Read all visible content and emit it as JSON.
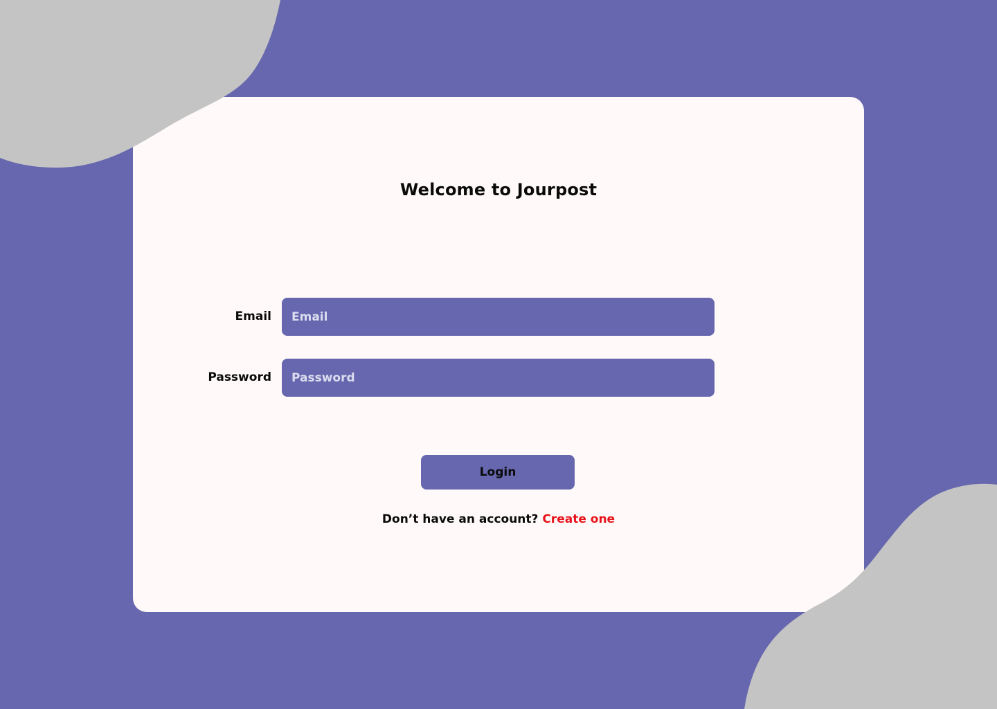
{
  "app": {
    "title": "Welcome to Jourpost"
  },
  "login_form": {
    "email": {
      "label": "Email",
      "placeholder": "Email",
      "value": ""
    },
    "password": {
      "label": "Password",
      "placeholder": "Password",
      "value": ""
    },
    "submit_label": "Login"
  },
  "signup": {
    "prompt": "Don’t have an account?",
    "link_label": "Create one"
  },
  "colors": {
    "background": "#6667ae",
    "card": "#fffaf9",
    "accent": "#6667ae",
    "decorative_blob": "#c4c4c4",
    "link": "#e8131a",
    "text": "#0a0a0a"
  },
  "decorations": {
    "blobs": [
      "top-left-blob",
      "bottom-right-blob"
    ]
  }
}
